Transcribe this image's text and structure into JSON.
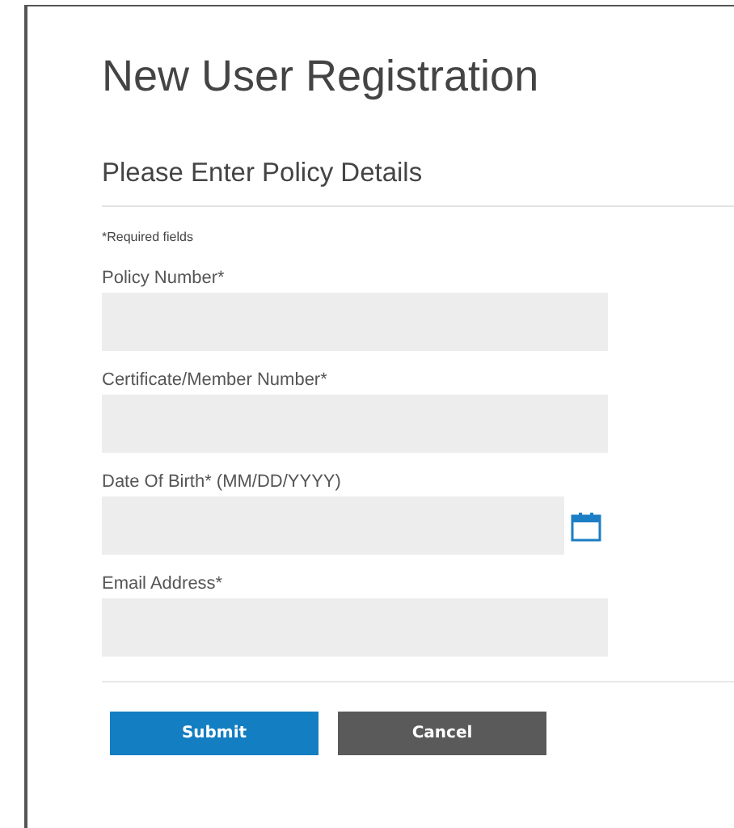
{
  "title": "New User Registration",
  "section_title": "Please Enter Policy Details",
  "required_note": "*Required fields",
  "fields": [
    {
      "label": "Policy Number*",
      "kind": "text"
    },
    {
      "label": "Certificate/Member Number*",
      "kind": "text"
    },
    {
      "label": "Date Of Birth* (MM/DD/YYYY)",
      "kind": "date"
    },
    {
      "label": "Email Address*",
      "kind": "text"
    }
  ],
  "buttons": [
    {
      "label": "Submit",
      "kind": "primary"
    },
    {
      "label": "Cancel",
      "kind": "secondary"
    }
  ]
}
